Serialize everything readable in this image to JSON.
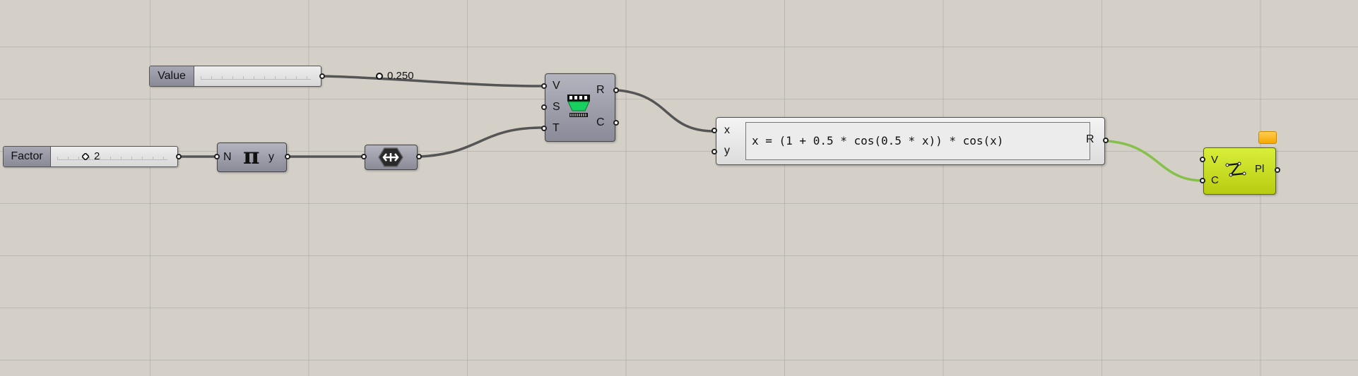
{
  "canvas": {
    "background": "#d4d0c8"
  },
  "components": {
    "value_slider": {
      "label": "Value",
      "value": "0.250"
    },
    "factor_slider": {
      "label": "Factor",
      "value": "2"
    },
    "pi": {
      "input": "N",
      "symbol": "π",
      "output": "y",
      "icon": "pi-icon"
    },
    "construct_domain": {
      "icon": "domain-icon"
    },
    "range": {
      "inputs": [
        "V",
        "S",
        "T"
      ],
      "outputs": [
        "R",
        "C"
      ],
      "icon": "film-strip-icon"
    },
    "expression": {
      "inputs": [
        "x",
        "y"
      ],
      "expression": "x = (1 + 0.5 * cos(0.5 * x)) * cos(x)",
      "output": "R"
    },
    "polyline": {
      "inputs": [
        "V",
        "C"
      ],
      "output": "Pl",
      "icon": "polyline-icon",
      "color": "#c8dc20"
    }
  },
  "wire_colors": {
    "default": "#555555",
    "selected": "#86c04a"
  }
}
